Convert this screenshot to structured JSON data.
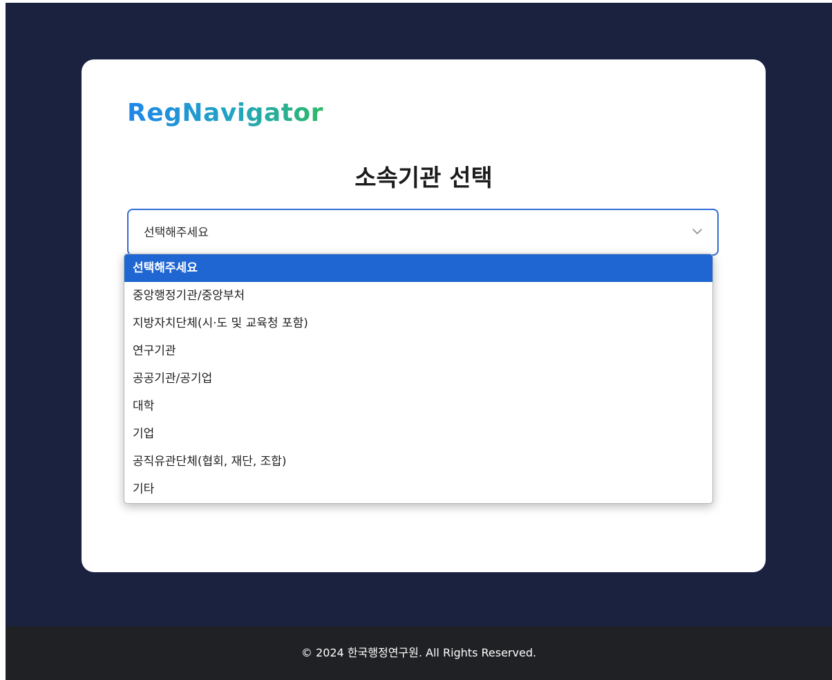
{
  "brand": {
    "logo_text": "RegNavigator"
  },
  "heading": "소속기관 선택",
  "select": {
    "current_value": "선택해주세요",
    "options": [
      "선택해주세요",
      "중앙행정기관/중앙부처",
      "지방자치단체(시·도 및 교육청 포함)",
      "연구기관",
      "공공기관/공기업",
      "대학",
      "기업",
      "공직유관단체(협회, 재단, 조합)",
      "기타"
    ],
    "selected_index": 0
  },
  "footer": {
    "copyright": "© 2024 한국행정연구원. All Rights Reserved."
  },
  "colors": {
    "page_background": "#1a2240",
    "accent": "#1f66d3",
    "footer_background": "#202124"
  },
  "icons": {
    "select_arrow": "chevron-down-icon"
  }
}
